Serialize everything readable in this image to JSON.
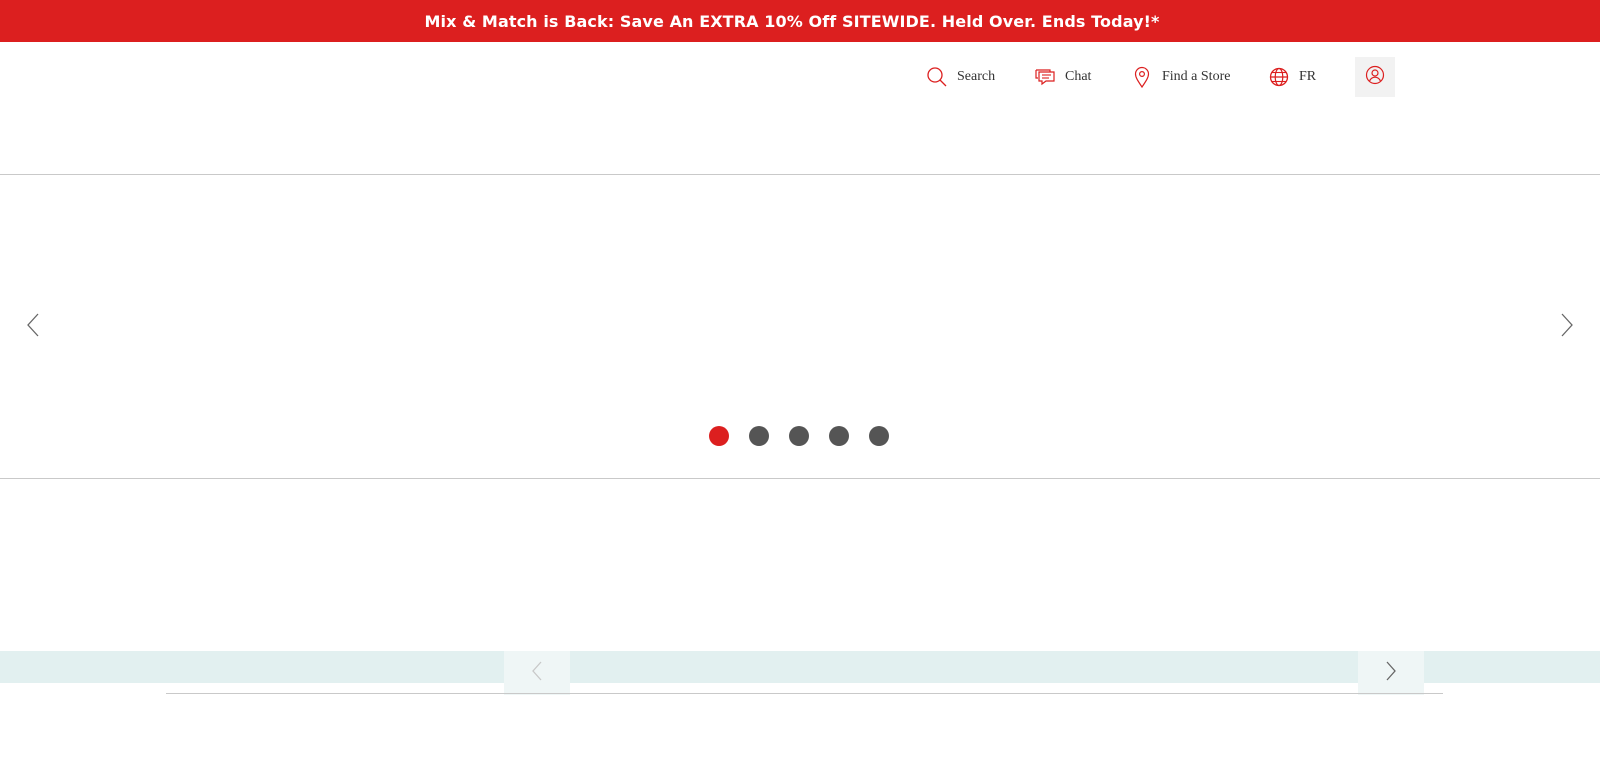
{
  "promo": {
    "text": "Mix & Match is Back: Save An EXTRA 10% Off SITEWIDE. Held Over. Ends Today!*"
  },
  "utility_nav": {
    "search_label": "Search",
    "chat_label": "Chat",
    "store_label": "Find a Store",
    "language_label": "FR"
  },
  "carousel": {
    "slide_count": 5,
    "active_slide": 1
  },
  "colors": {
    "brand_red": "#dc1f1f",
    "dot_inactive": "#555555",
    "band_teal": "#e2f0f0"
  },
  "icons": {
    "search": "search-icon",
    "chat": "chat-icon",
    "store": "location-pin-icon",
    "language": "globe-icon",
    "account": "user-icon",
    "prev": "chevron-left-icon",
    "next": "chevron-right-icon"
  }
}
